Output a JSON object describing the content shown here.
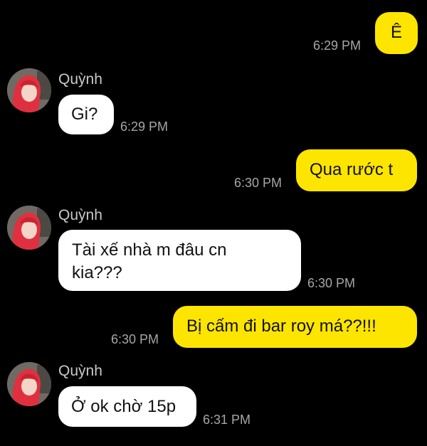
{
  "colors": {
    "background": "#000000",
    "outgoing_bubble": "#FEE500",
    "incoming_bubble": "#FFFFFF",
    "timestamp": "#A7A7A7",
    "sender_name": "#C9C9C9",
    "avatar_hair": "#E0303F"
  },
  "messages": [
    {
      "direction": "out",
      "text": "Ê",
      "time": "6:29 PM"
    },
    {
      "direction": "in",
      "sender": "Quỳnh",
      "avatar": "profile-photo-icon",
      "text": "Gi?",
      "time": "6:29 PM"
    },
    {
      "direction": "out",
      "text": "Qua rước t",
      "time": "6:30 PM"
    },
    {
      "direction": "in",
      "sender": "Quỳnh",
      "avatar": "profile-photo-icon",
      "text_lines": [
        "Tài xế nhà m đâu cn",
        "kia???"
      ],
      "time": "6:30 PM"
    },
    {
      "direction": "out",
      "text": "Bị cấm đi bar roy má??!!!",
      "time": "6:30 PM"
    },
    {
      "direction": "in",
      "sender": "Quỳnh",
      "avatar": "profile-photo-icon",
      "text": "Ở ok chờ 15p",
      "time": "6:31 PM"
    }
  ]
}
